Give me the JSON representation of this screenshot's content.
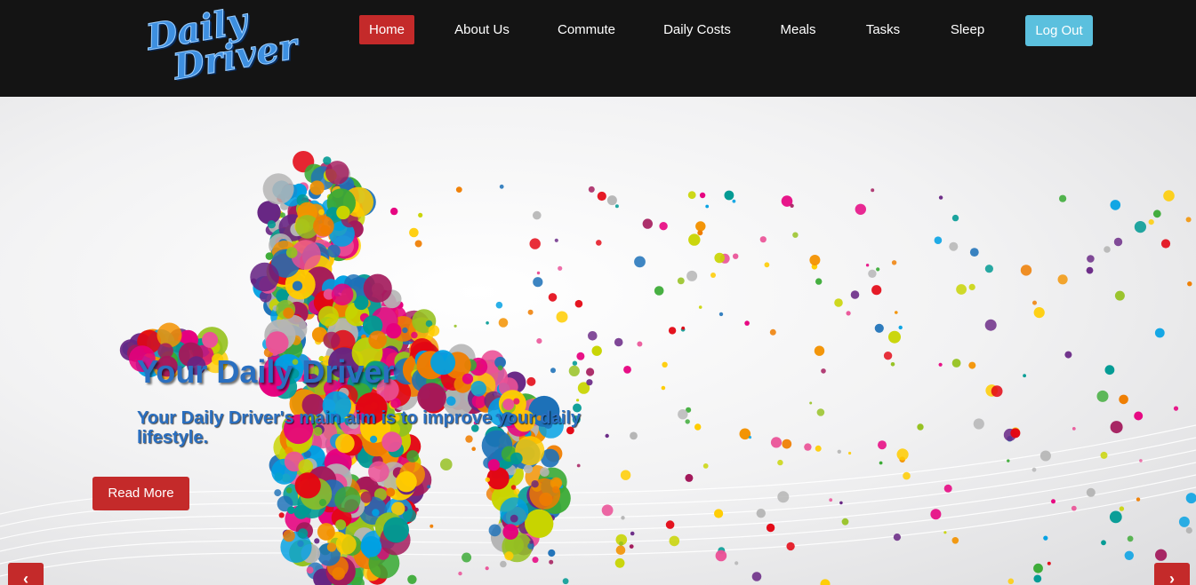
{
  "brand": {
    "logo_line1": "Daily",
    "logo_line2": "Driver",
    "logo_color": "#3d8fe0"
  },
  "nav": {
    "items": [
      {
        "label": "Home",
        "active": true
      },
      {
        "label": "About Us",
        "active": false
      },
      {
        "label": "Commute",
        "active": false
      },
      {
        "label": "Daily Costs",
        "active": false
      },
      {
        "label": "Meals",
        "active": false
      },
      {
        "label": "Tasks",
        "active": false
      },
      {
        "label": "Sleep",
        "active": false
      }
    ],
    "logout_label": "Log Out"
  },
  "hero": {
    "title": "Your Daily Driver",
    "subtitle": "Your Daily Driver's main aim is to improve your daily lifestyle.",
    "cta_label": "Read More",
    "prev_icon": "chevron-left-icon",
    "next_icon": "chevron-right-icon"
  },
  "colors": {
    "navbar_bg": "#141414",
    "accent_red": "#c42a2a",
    "logout_blue": "#5bc0de",
    "title_blue": "#2a6fc0"
  }
}
